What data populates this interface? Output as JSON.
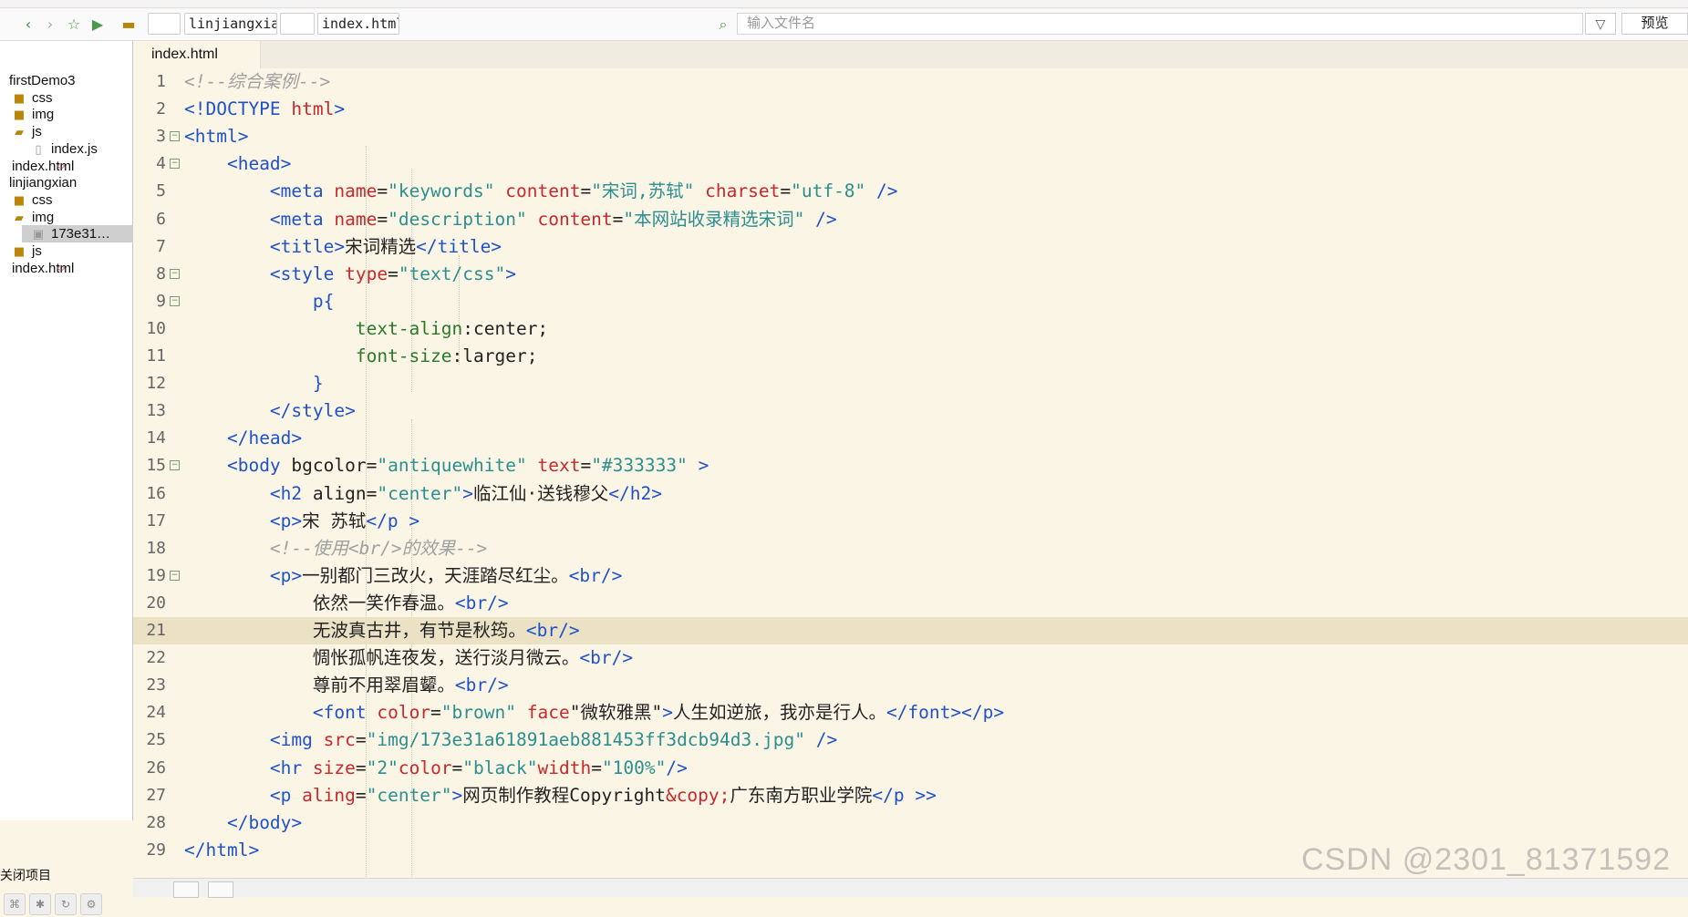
{
  "toolbar": {
    "project_box": "linjiangxian",
    "file_box": "index.html",
    "search_placeholder": "输入文件名",
    "filter_icon": "funnel-icon",
    "preview_label": "预览"
  },
  "sidebar": {
    "items": [
      {
        "label": "firstDemo3",
        "icon": "folder-open-icon",
        "indent": 0
      },
      {
        "label": "css",
        "icon": "folder-icon",
        "indent": 1
      },
      {
        "label": "img",
        "icon": "folder-icon",
        "indent": 1
      },
      {
        "label": "js",
        "icon": "folder-open-icon",
        "indent": 1
      },
      {
        "label": "index.js",
        "icon": "js-file-icon",
        "indent": 2
      },
      {
        "label": "index.html",
        "icon": "html-file-icon",
        "indent": 1
      },
      {
        "label": "linjiangxian",
        "icon": "folder-open-icon",
        "indent": 0
      },
      {
        "label": "css",
        "icon": "folder-icon",
        "indent": 1
      },
      {
        "label": "img",
        "icon": "folder-open-icon",
        "indent": 1
      },
      {
        "label": "173e31…",
        "icon": "image-file-icon",
        "indent": 2,
        "selected": true
      },
      {
        "label": "js",
        "icon": "folder-icon",
        "indent": 1
      },
      {
        "label": "index.html",
        "icon": "html-file-icon",
        "indent": 1
      }
    ],
    "close_project": "关闭项目"
  },
  "tab": {
    "label": "index.html"
  },
  "editor": {
    "highlighted_line": 21,
    "lines": [
      {
        "n": "1",
        "html": "<span class='c-cm'>&lt;!--综合案例--&gt;</span>"
      },
      {
        "n": "2",
        "html": "<span class='c-tag'>&lt;!DOCTYPE </span><span class='c-dt'>html</span><span class='c-tag'>&gt;</span>"
      },
      {
        "n": "3",
        "fold": true,
        "html": "<span class='c-tag'>&lt;html&gt;</span>"
      },
      {
        "n": "4",
        "fold": true,
        "html": "    <span class='c-tag'>&lt;head&gt;</span>"
      },
      {
        "n": "5",
        "html": "        <span class='c-tag'>&lt;meta </span><span class='c-at'>name</span>=<span class='c-val'>\"keywords\"</span> <span class='c-at'>content</span>=<span class='c-val'>\"宋词,苏轼\"</span> <span class='c-at'>charset</span>=<span class='c-val'>\"utf-8\"</span> <span class='c-tag'>/&gt;</span>"
      },
      {
        "n": "6",
        "html": "        <span class='c-tag'>&lt;meta </span><span class='c-at'>name</span>=<span class='c-val'>\"description\"</span> <span class='c-at'>content</span>=<span class='c-val'>\"本网站收录精选宋词\"</span> <span class='c-tag'>/&gt;</span>"
      },
      {
        "n": "7",
        "html": "        <span class='c-tag'>&lt;title&gt;</span>宋词精选<span class='c-tag'>&lt;/title&gt;</span>"
      },
      {
        "n": "8",
        "fold": true,
        "html": "        <span class='c-tag'>&lt;style </span><span class='c-at'>type</span>=<span class='c-val'>\"text/css\"</span><span class='c-tag'>&gt;</span>"
      },
      {
        "n": "9",
        "fold": true,
        "html": "            <span class='c-tag'>p{</span>"
      },
      {
        "n": "10",
        "html": "                <span class='c-prop'>text-align</span>:center;"
      },
      {
        "n": "11",
        "html": "                <span class='c-prop'>font-size</span>:larger;"
      },
      {
        "n": "12",
        "html": "            <span class='c-tag'>}</span>"
      },
      {
        "n": "13",
        "html": "        <span class='c-tag'>&lt;/style&gt;</span>"
      },
      {
        "n": "14",
        "html": "    <span class='c-tag'>&lt;/head&gt;</span>"
      },
      {
        "n": "15",
        "fold": true,
        "html": "    <span class='c-tag'>&lt;body </span>bgcolor=<span class='c-val'>\"antiquewhite\"</span> <span class='c-at'>text</span>=<span class='c-val'>\"#333333\"</span> <span class='c-tag'>&gt;</span>"
      },
      {
        "n": "16",
        "html": "        <span class='c-tag'>&lt;h2 </span>align=<span class='c-val'>\"center\"</span><span class='c-tag'>&gt;</span>临江仙·送钱穆父<span class='c-tag'>&lt;/h2&gt;</span>"
      },
      {
        "n": "17",
        "html": "        <span class='c-tag'>&lt;p&gt;</span>宋 苏轼<span class='c-tag'>&lt;/p &gt;</span>"
      },
      {
        "n": "18",
        "html": "        <span class='c-cm'>&lt;!--使用&lt;br/&gt;的效果--&gt;</span>"
      },
      {
        "n": "19",
        "fold": true,
        "html": "        <span class='c-tag'>&lt;p&gt;</span>一别都门三改火，天涯踏尽红尘。<span class='c-tag'>&lt;br/&gt;</span>"
      },
      {
        "n": "20",
        "html": "            依然一笑作春温。<span class='c-tag'>&lt;br/&gt;</span>"
      },
      {
        "n": "21",
        "html": "            无波真古井，有节是秋筠。<span class='c-tag'>&lt;br/&gt;</span>"
      },
      {
        "n": "22",
        "html": "            惆怅孤帆连夜发，送行淡月微云。<span class='c-tag'>&lt;br/&gt;</span>"
      },
      {
        "n": "23",
        "html": "            尊前不用翠眉颦。<span class='c-tag'>&lt;br/&gt;</span>"
      },
      {
        "n": "24",
        "html": "            <span class='c-tag'>&lt;font </span><span class='c-at'>color</span>=<span class='c-val'>\"brown\"</span> <span class='c-at'>face</span>\"微软雅黑\"<span class='c-tag'>&gt;</span>人生如逆旅，我亦是行人。<span class='c-tag'>&lt;/font&gt;&lt;/p&gt;</span>"
      },
      {
        "n": "25",
        "html": "        <span class='c-tag'>&lt;img </span><span class='c-at'>src</span>=<span class='c-val'>\"img/173e31a61891aeb881453ff3dcb94d3.jpg\"</span> <span class='c-tag'>/&gt;</span>"
      },
      {
        "n": "26",
        "html": "        <span class='c-tag'>&lt;hr </span><span class='c-at'>size</span>=<span class='c-val'>\"2\"</span><span class='c-at'>color</span>=<span class='c-val'>\"black\"</span><span class='c-at'>width</span>=<span class='c-val'>\"100%\"</span><span class='c-tag'>/&gt;</span>"
      },
      {
        "n": "27",
        "html": "        <span class='c-tag'>&lt;p </span><span class='c-at'>aling</span>=<span class='c-val'>\"center\"</span><span class='c-tag'>&gt;</span>网页制作教程Copyright<span class='c-ent'>&amp;copy;</span>广东南方职业学院<span class='c-tag'>&lt;/p &gt;&gt;</span>"
      },
      {
        "n": "28",
        "html": "    <span class='c-tag'>&lt;/body&gt;</span>"
      },
      {
        "n": "29",
        "html": "<span class='c-tag'>&lt;/html&gt;</span>"
      }
    ]
  },
  "watermark": "CSDN @2301_81371592"
}
